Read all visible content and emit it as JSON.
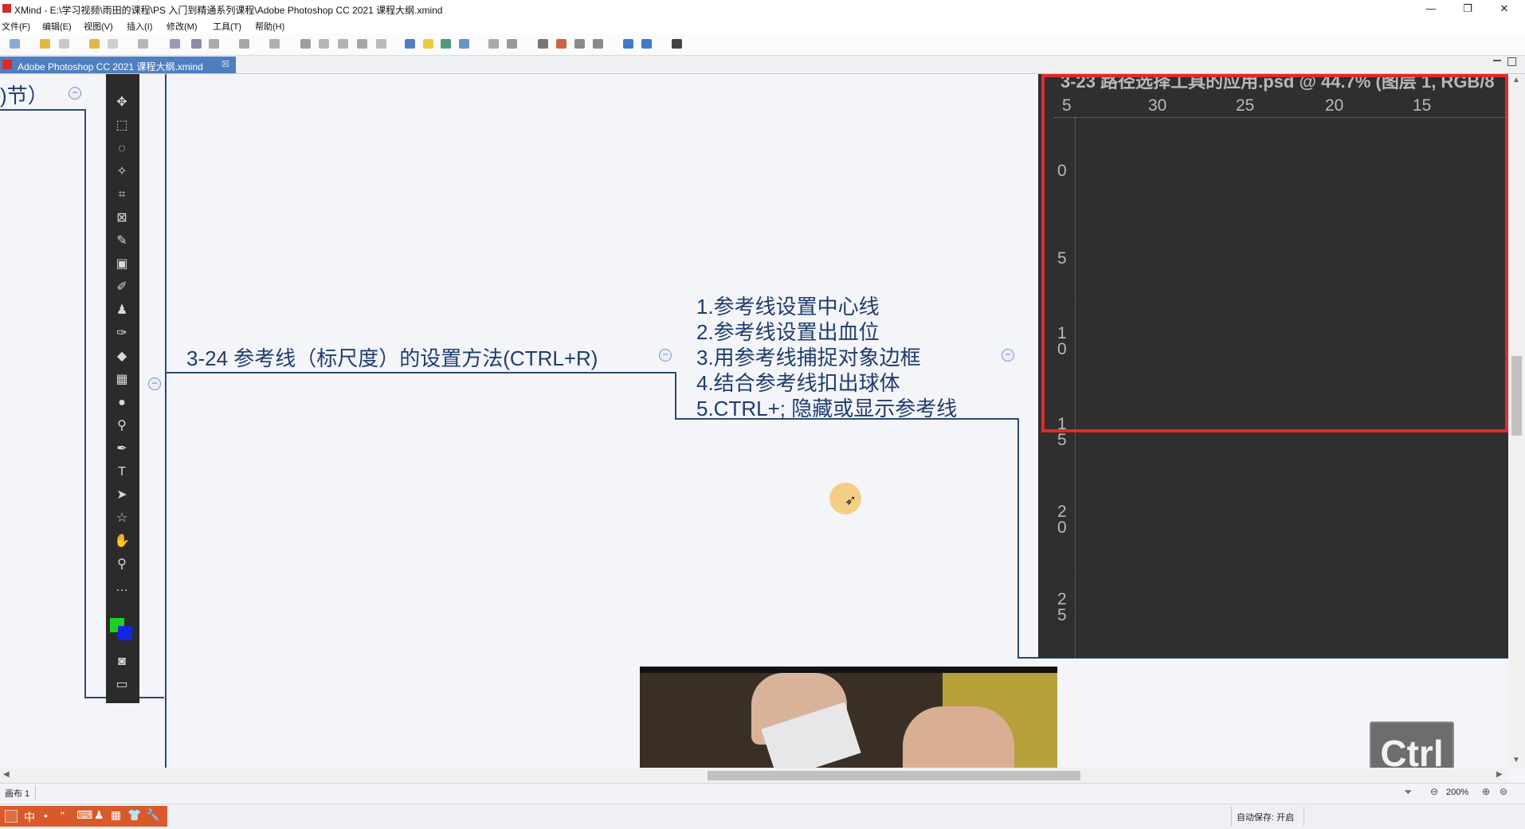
{
  "window": {
    "title": "XMind - E:\\学习视频\\雨田的课程\\PS 入门到精通系列课程\\Adobe Photoshop CC 2021 课程大纲.xmind",
    "min": "—",
    "restore": "❐",
    "close": "✕"
  },
  "menu": [
    "文件(F)",
    "编辑(E)",
    "视图(V)",
    "插入(I)",
    "修改(M)",
    "工具(T)",
    "帮助(H)"
  ],
  "tab": {
    "label": "Adobe Photoshop CC 2021 课程大纲.xmind",
    "close": "☒"
  },
  "mindmap": {
    "left_topic": ")节）",
    "main_topic": "3-24 参考线（标尺度）的设置方法(CTRL+R)",
    "subtopics": [
      "1.参考线设置中心线",
      "2.参考线设置出血位",
      "3.用参考线捕捉对象边框",
      "4.结合参考线扣出球体",
      "5.CTRL+; 隐藏或显示参考线"
    ],
    "collapse": "−"
  },
  "ps": {
    "doc_title": "3-23 路径选择工具的应用.psd @ 44.7% (图层 1, RGB/8",
    "ruler_h": [
      "5",
      "30",
      "25",
      "20",
      "15"
    ],
    "ruler_v": [
      "0",
      "5",
      "1\n0",
      "1\n5",
      "2\n0",
      "2\n5"
    ]
  },
  "overlay": {
    "key": "Ctrl"
  },
  "status": {
    "sheet": "画布 1",
    "zoom": "200%",
    "autosave": "自动保存: 开启"
  },
  "ime": [
    "中",
    "•",
    "\"",
    "⌨",
    "♟",
    "▦",
    "👕",
    "🔧"
  ]
}
